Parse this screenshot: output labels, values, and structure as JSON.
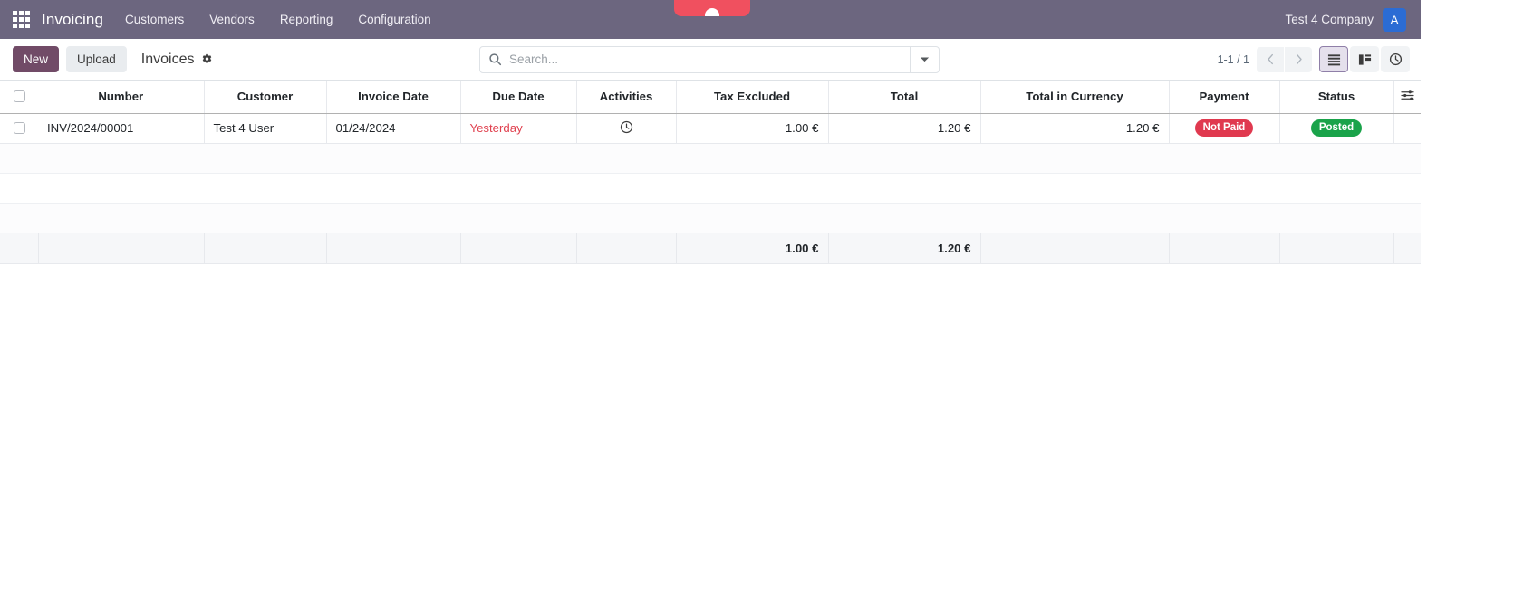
{
  "navbar": {
    "apps_icon": "apps-grid-icon",
    "brand": "Invoicing",
    "menus": [
      {
        "label": "Customers"
      },
      {
        "label": "Vendors"
      },
      {
        "label": "Reporting"
      },
      {
        "label": "Configuration"
      }
    ],
    "company": "Test 4 Company",
    "avatar_initial": "A",
    "bg_color": "#6c667f",
    "avatar_color": "#2b6cd4"
  },
  "toast": {
    "color": "#f0505f"
  },
  "control_panel": {
    "new_label": "New",
    "upload_label": "Upload",
    "breadcrumb_title": "Invoices",
    "settings_icon": "gear-icon",
    "search": {
      "placeholder": "Search...",
      "value": "",
      "icon": "search-icon",
      "dropdown_icon": "caret-down-icon"
    },
    "pager": {
      "value": "1-1 / 1",
      "prev_icon": "chevron-left-icon",
      "next_icon": "chevron-right-icon"
    },
    "views": [
      {
        "name": "list",
        "icon": "list-view-icon",
        "active": true
      },
      {
        "name": "kanban",
        "icon": "kanban-view-icon",
        "active": false
      },
      {
        "name": "activity",
        "icon": "activity-clock-icon",
        "active": false
      }
    ]
  },
  "list": {
    "columns": [
      {
        "label": "Number",
        "align": "center"
      },
      {
        "label": "Customer",
        "align": "center"
      },
      {
        "label": "Invoice Date",
        "align": "center"
      },
      {
        "label": "Due Date",
        "align": "center"
      },
      {
        "label": "Activities",
        "align": "center"
      },
      {
        "label": "Tax Excluded",
        "align": "center"
      },
      {
        "label": "Total",
        "align": "center"
      },
      {
        "label": "Total in Currency",
        "align": "center"
      },
      {
        "label": "Payment",
        "align": "center"
      },
      {
        "label": "Status",
        "align": "center"
      }
    ],
    "optional_columns_icon": "column-settings-icon",
    "rows": [
      {
        "number": "INV/2024/00001",
        "customer": "Test 4 User",
        "invoice_date": "01/24/2024",
        "due_date": "Yesterday",
        "due_date_overdue": true,
        "activity_icon": "activity-clock-icon",
        "tax_excluded": "1.00 €",
        "total": "1.20 €",
        "total_in_currency": "1.20 €",
        "payment_badge": "Not Paid",
        "payment_badge_color": "#e0394f",
        "status_badge": "Posted",
        "status_badge_color": "#1aa34a"
      }
    ],
    "footer": {
      "tax_excluded": "1.00 €",
      "total": "1.20 €",
      "total_in_currency": ""
    }
  }
}
